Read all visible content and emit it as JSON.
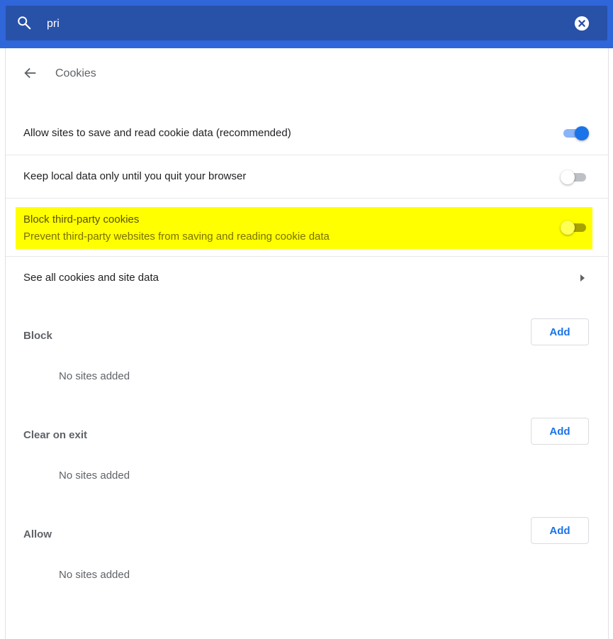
{
  "search": {
    "value": "pri",
    "placeholder": "Search settings"
  },
  "page": {
    "title": "Cookies"
  },
  "settings": [
    {
      "label": "Allow sites to save and read cookie data (recommended)",
      "enabled": true
    },
    {
      "label": "Keep local data only until you quit your browser",
      "enabled": false
    },
    {
      "label": "Block third-party cookies",
      "sublabel": "Prevent third-party websites from saving and reading cookie data",
      "enabled": false,
      "highlighted": true
    }
  ],
  "see_all": {
    "label": "See all cookies and site data"
  },
  "sections": [
    {
      "title": "Block",
      "add_label": "Add",
      "empty_text": "No sites added"
    },
    {
      "title": "Clear on exit",
      "add_label": "Add",
      "empty_text": "No sites added"
    },
    {
      "title": "Allow",
      "add_label": "Add",
      "empty_text": "No sites added"
    }
  ],
  "colors": {
    "header": "#2f66d9",
    "search_bg": "#2851a8",
    "accent": "#1a73e8",
    "highlight": "#ffff00"
  },
  "icons": {
    "search": "search-icon",
    "clear": "clear-search-icon",
    "back": "back-arrow-icon",
    "chevron": "chevron-right-icon"
  }
}
